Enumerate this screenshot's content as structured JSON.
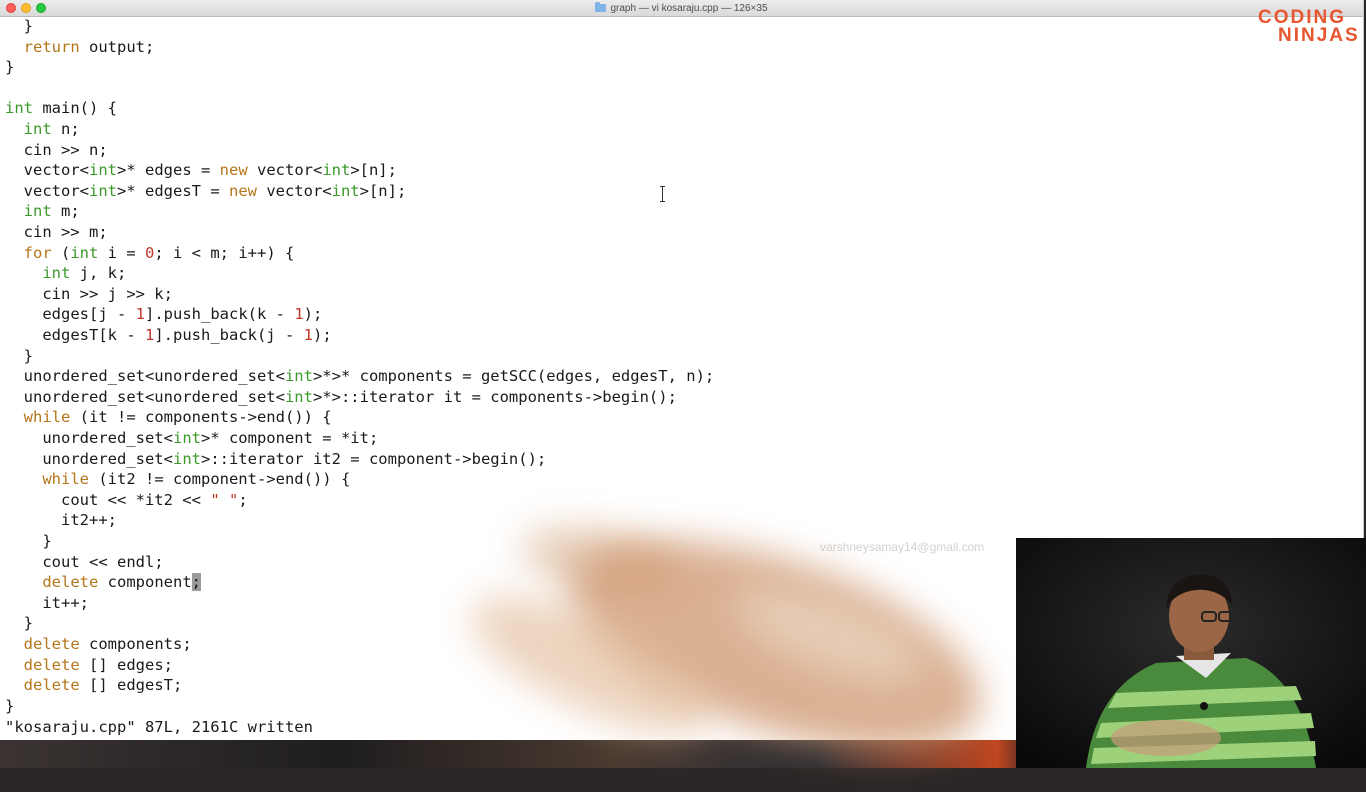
{
  "window": {
    "title": "graph — vi kosaraju.cpp — 126×35"
  },
  "editor": {
    "lines": [
      [
        {
          "t": "  }"
        }
      ],
      [
        {
          "t": "  "
        },
        {
          "t": "return",
          "c": "kw"
        },
        {
          "t": " output;"
        }
      ],
      [
        {
          "t": "}"
        }
      ],
      [
        {
          "t": ""
        }
      ],
      [
        {
          "t": "int",
          "c": "type"
        },
        {
          "t": " main() {"
        }
      ],
      [
        {
          "t": "  "
        },
        {
          "t": "int",
          "c": "type"
        },
        {
          "t": " n;"
        }
      ],
      [
        {
          "t": "  cin >> n;"
        }
      ],
      [
        {
          "t": "  vector<"
        },
        {
          "t": "int",
          "c": "type"
        },
        {
          "t": ">* edges = "
        },
        {
          "t": "new",
          "c": "kw"
        },
        {
          "t": " vector<"
        },
        {
          "t": "int",
          "c": "type"
        },
        {
          "t": ">[n];"
        }
      ],
      [
        {
          "t": "  vector<"
        },
        {
          "t": "int",
          "c": "type"
        },
        {
          "t": ">* edgesT = "
        },
        {
          "t": "new",
          "c": "kw"
        },
        {
          "t": " vector<"
        },
        {
          "t": "int",
          "c": "type"
        },
        {
          "t": ">[n];"
        }
      ],
      [
        {
          "t": "  "
        },
        {
          "t": "int",
          "c": "type"
        },
        {
          "t": " m;"
        }
      ],
      [
        {
          "t": "  cin >> m;"
        }
      ],
      [
        {
          "t": "  "
        },
        {
          "t": "for",
          "c": "kw"
        },
        {
          "t": " ("
        },
        {
          "t": "int",
          "c": "type"
        },
        {
          "t": " i = "
        },
        {
          "t": "0",
          "c": "num"
        },
        {
          "t": "; i < m; i++) {"
        }
      ],
      [
        {
          "t": "    "
        },
        {
          "t": "int",
          "c": "type"
        },
        {
          "t": " j, k;"
        }
      ],
      [
        {
          "t": "    cin >> j >> k;"
        }
      ],
      [
        {
          "t": "    edges[j - "
        },
        {
          "t": "1",
          "c": "num"
        },
        {
          "t": "].push_back(k - "
        },
        {
          "t": "1",
          "c": "num"
        },
        {
          "t": ");"
        }
      ],
      [
        {
          "t": "    edgesT[k - "
        },
        {
          "t": "1",
          "c": "num"
        },
        {
          "t": "].push_back(j - "
        },
        {
          "t": "1",
          "c": "num"
        },
        {
          "t": ");"
        }
      ],
      [
        {
          "t": "  }"
        }
      ],
      [
        {
          "t": "  unordered_set<unordered_set<"
        },
        {
          "t": "int",
          "c": "type"
        },
        {
          "t": ">*>* components = getSCC(edges, edgesT, n);"
        }
      ],
      [
        {
          "t": "  unordered_set<unordered_set<"
        },
        {
          "t": "int",
          "c": "type"
        },
        {
          "t": ">*>::iterator it = components->begin();"
        }
      ],
      [
        {
          "t": "  "
        },
        {
          "t": "while",
          "c": "kw"
        },
        {
          "t": " (it != components->end()) {"
        }
      ],
      [
        {
          "t": "    unordered_set<"
        },
        {
          "t": "int",
          "c": "type"
        },
        {
          "t": ">* component = *it;"
        }
      ],
      [
        {
          "t": "    unordered_set<"
        },
        {
          "t": "int",
          "c": "type"
        },
        {
          "t": ">::iterator it2 = component->begin();"
        }
      ],
      [
        {
          "t": "    "
        },
        {
          "t": "while",
          "c": "kw"
        },
        {
          "t": " (it2 != component->end()) {"
        }
      ],
      [
        {
          "t": "      cout << *it2 << "
        },
        {
          "t": "\" \"",
          "c": "str"
        },
        {
          "t": ";"
        }
      ],
      [
        {
          "t": "      it2++;"
        }
      ],
      [
        {
          "t": "    }"
        }
      ],
      [
        {
          "t": "    cout << endl;"
        }
      ],
      [
        {
          "t": "    "
        },
        {
          "t": "delete",
          "c": "kw"
        },
        {
          "t": " component"
        },
        {
          "t": ";",
          "c": "cursor"
        }
      ],
      [
        {
          "t": "    it++;"
        }
      ],
      [
        {
          "t": "  }"
        }
      ],
      [
        {
          "t": "  "
        },
        {
          "t": "delete",
          "c": "kw"
        },
        {
          "t": " components;"
        }
      ],
      [
        {
          "t": "  "
        },
        {
          "t": "delete",
          "c": "kw"
        },
        {
          "t": " [] edges;"
        }
      ],
      [
        {
          "t": "  "
        },
        {
          "t": "delete",
          "c": "kw"
        },
        {
          "t": " [] edgesT;"
        }
      ],
      [
        {
          "t": "}"
        }
      ]
    ],
    "status": "\"kosaraju.cpp\" 87L, 2161C written"
  },
  "logo": {
    "line1": "CODING",
    "line2": "NINJAS"
  },
  "watermark": "varshneysamay14@gmail.com",
  "colors": {
    "keyword": "#b5761b",
    "type": "#3c9a2c",
    "number": "#c0392b",
    "logo": "#e8562f"
  }
}
